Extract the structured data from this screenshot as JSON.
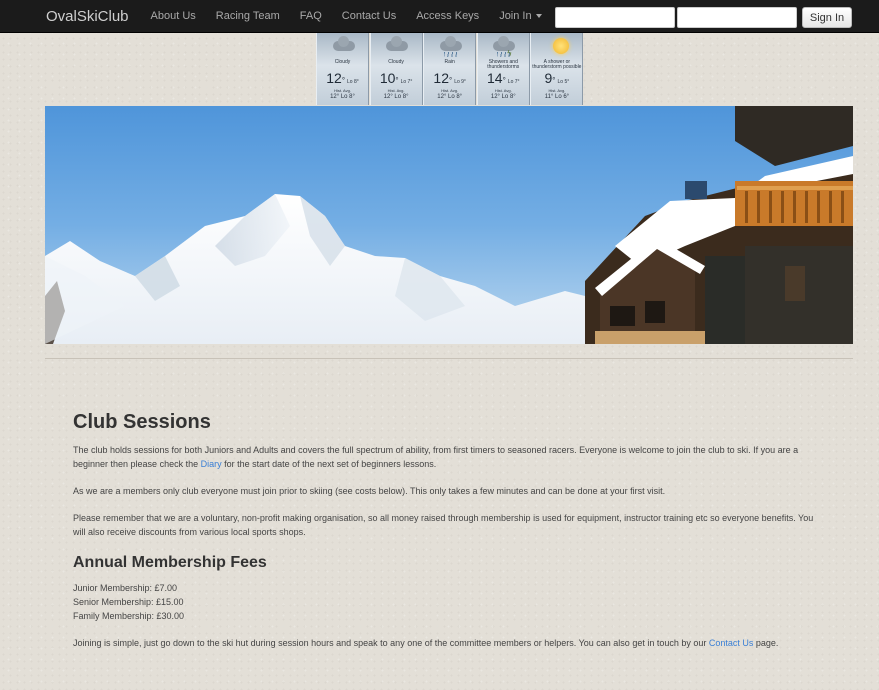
{
  "nav": {
    "brand": "OvalSkiClub",
    "links": [
      "About Us",
      "Racing Team",
      "FAQ",
      "Contact Us",
      "Access Keys"
    ],
    "join_in": "Join In",
    "username_value": "",
    "password_value": "",
    "signin_label": "Sign In"
  },
  "weather": [
    {
      "condition": "Cloudy",
      "hi": "12",
      "lo": "Lo 8°",
      "avg_label": "Hist. Avg.",
      "avg": "12° Lo 8°",
      "icon": "cloud-icon"
    },
    {
      "condition": "Cloudy",
      "hi": "10",
      "lo": "Lo 7°",
      "avg_label": "Hist. Avg.",
      "avg": "12° Lo 8°",
      "icon": "cloud-icon"
    },
    {
      "condition": "Rain",
      "hi": "12",
      "lo": "Lo 9°",
      "avg_label": "Hist. Avg.",
      "avg": "12° Lo 8°",
      "icon": "rain-icon"
    },
    {
      "condition": "Showers and thunderstorms",
      "hi": "14",
      "lo": "Lo 7°",
      "avg_label": "Hist. Avg.",
      "avg": "12° Lo 8°",
      "icon": "thunderstorm-icon"
    },
    {
      "condition": "A shower or thunderstorm possible",
      "hi": "9",
      "lo": "Lo 5°",
      "avg_label": "Hist. Avg.",
      "avg": "11° Lo 6°",
      "icon": "sun-icon"
    }
  ],
  "sessions": {
    "title": "Club Sessions",
    "p1_before": "The club holds sessions for both Juniors and Adults and covers the full spectrum of ability, from first timers to seasoned racers. Everyone is welcome to join the club to ski. If you are a beginner then please check the ",
    "p1_link": "Diary",
    "p1_after": " for the start date of the next set of beginners lessons.",
    "p2": "As we are a members only club everyone must join prior to skiing (see costs below). This only takes a few minutes and can be done at your first visit.",
    "p3": "Please remember that we are a voluntary, non-profit making organisation, so all money raised through membership is used for equipment, instructor training etc so everyone benefits. You will also receive discounts from various local sports shops."
  },
  "fees": {
    "title": "Annual Membership Fees",
    "items": [
      "Junior Membership: £7.00",
      "Senior Membership: £15.00",
      "Family Membership: £30.00"
    ],
    "join_before": "Joining is simple, just go down to the ski hut during session hours and speak to any one of the committee members or helpers. You can also get in touch by our ",
    "join_link": "Contact Us",
    "join_after": " page."
  }
}
